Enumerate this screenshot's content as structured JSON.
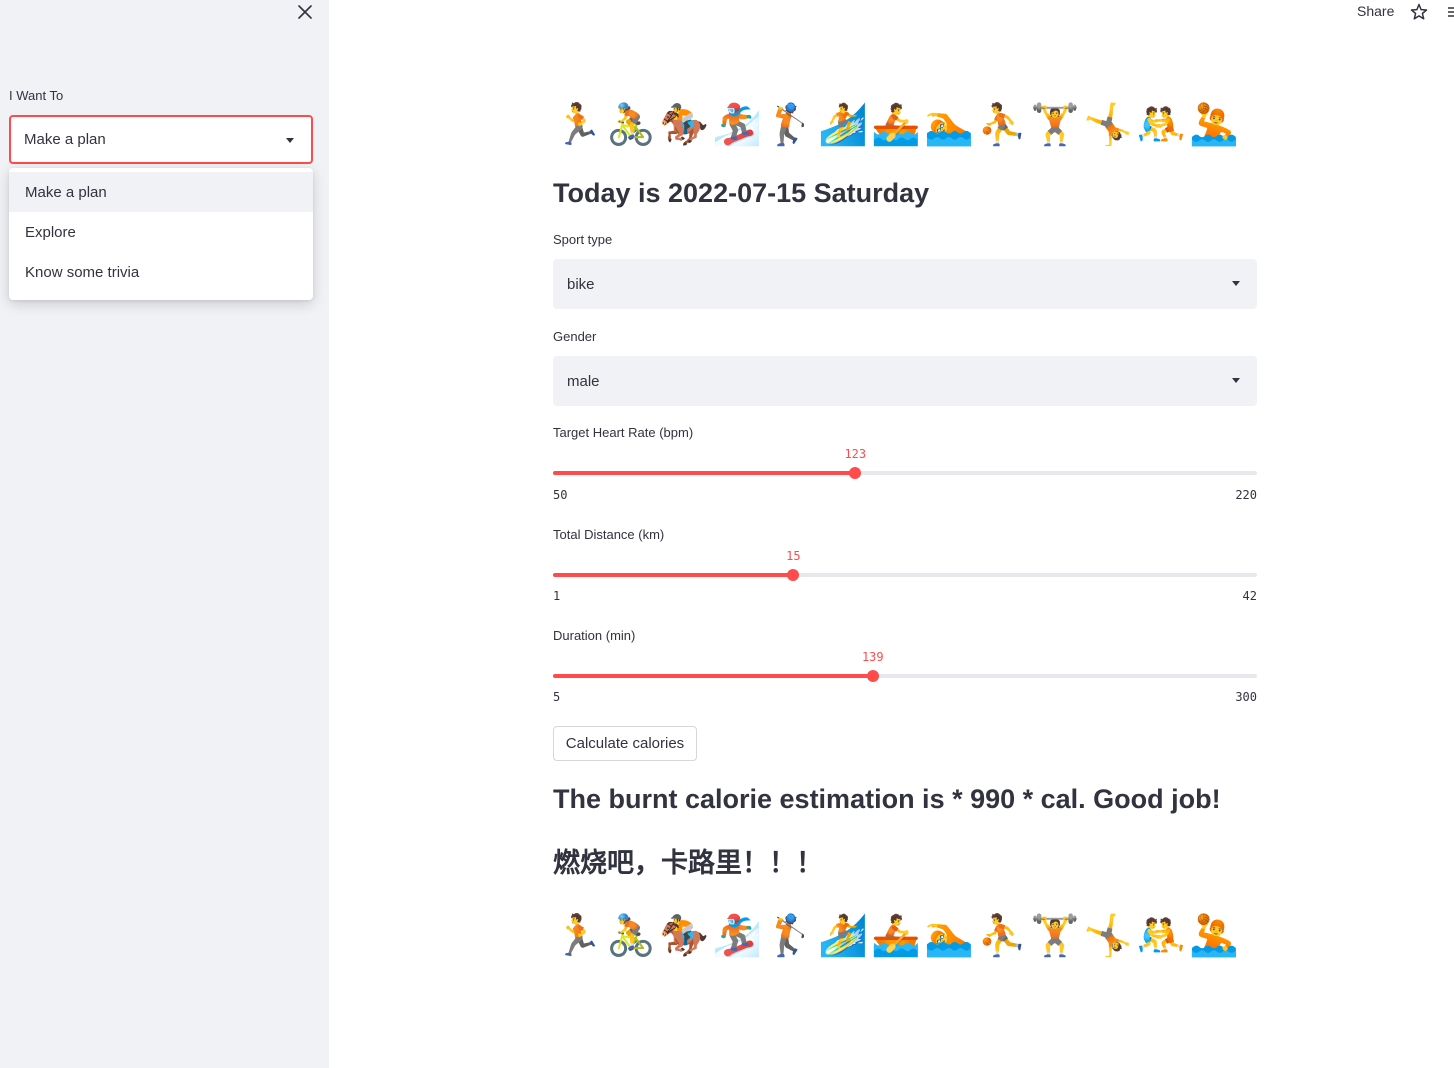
{
  "sidebar": {
    "label": "I Want To",
    "selected": "Make a plan",
    "options": [
      "Make a plan",
      "Explore",
      "Know some trivia"
    ]
  },
  "header": {
    "share_label": "Share"
  },
  "emojis": [
    "🏃",
    "🚴",
    "🏇",
    "🏂",
    "🏌",
    "🏄",
    "🚣",
    "🏊",
    "⛹",
    "🏋",
    "🤸",
    "🤼",
    "🤽"
  ],
  "main": {
    "title": "Today is 2022-07-15 Saturday",
    "sport": {
      "label": "Sport type",
      "value": "bike"
    },
    "gender": {
      "label": "Gender",
      "value": "male"
    },
    "sliders": [
      {
        "label": "Target Heart Rate (bpm)",
        "value": 123,
        "min": 50,
        "max": 220
      },
      {
        "label": "Total Distance (km)",
        "value": 15,
        "min": 1,
        "max": 42
      },
      {
        "label": "Duration (min)",
        "value": 139,
        "min": 5,
        "max": 300
      }
    ],
    "button_label": "Calculate calories",
    "result": "The burnt calorie estimation is * 990 * cal. Good job!",
    "slogan": "燃烧吧，卡路里！！！"
  },
  "colors": {
    "accent": "#ff4b4b",
    "sidebar_bg": "#f0f2f6",
    "text": "#31333f"
  }
}
